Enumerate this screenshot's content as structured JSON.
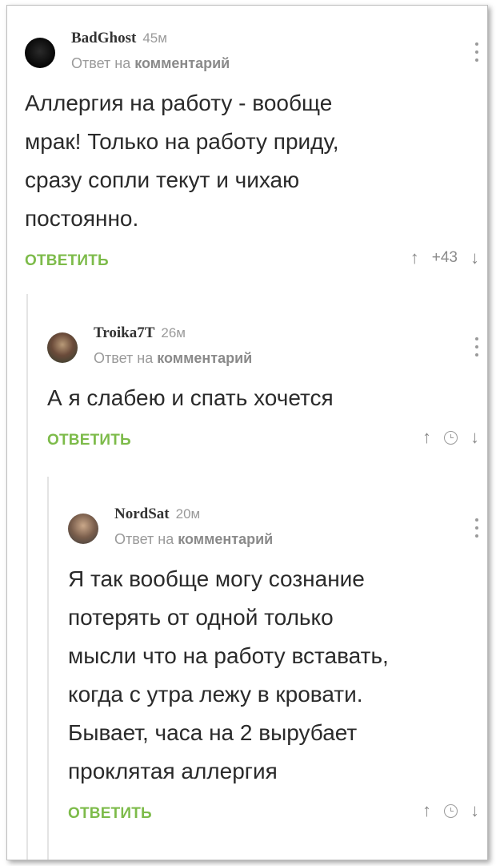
{
  "comments": [
    {
      "nick": "BadGhost",
      "time": "45м",
      "reply_prefix": "Ответ на",
      "reply_link": "комментарий",
      "text_lines": [
        "Аллергия на работу - вообще",
        "мрак! Только на работу приду,",
        "сразу сопли текут и чихаю",
        "постоянно."
      ],
      "reply_label": "ОТВЕТИТЬ",
      "score": "+43",
      "up_icon": "arrow-up-icon",
      "down_icon": "arrow-down-icon"
    },
    {
      "nick": "Troika7T",
      "time": "26м",
      "reply_prefix": "Ответ на",
      "reply_link": "комментарий",
      "text_lines": [
        "А я слабею и спать хочется"
      ],
      "reply_label": "ОТВЕТИТЬ",
      "score_icon": "clock-icon",
      "up_icon": "arrow-up-icon",
      "down_icon": "arrow-down-icon"
    },
    {
      "nick": "NordSat",
      "time": "20м",
      "reply_prefix": "Ответ на",
      "reply_link": "комментарий",
      "text_lines": [
        "Я так вообще могу сознание",
        "потерять от одной только",
        "мысли что на работу вставать,",
        "когда с утра лежу в кровати.",
        "Бывает, часа на 2 вырубает",
        "проклятая аллергия"
      ],
      "reply_label": "ОТВЕТИТЬ",
      "score_icon": "clock-icon",
      "up_icon": "arrow-up-icon",
      "down_icon": "arrow-down-icon"
    }
  ],
  "colors": {
    "reply_green": "#7dbb4a",
    "muted_gray": "#9a9a9a",
    "text": "#2a2a2a"
  }
}
